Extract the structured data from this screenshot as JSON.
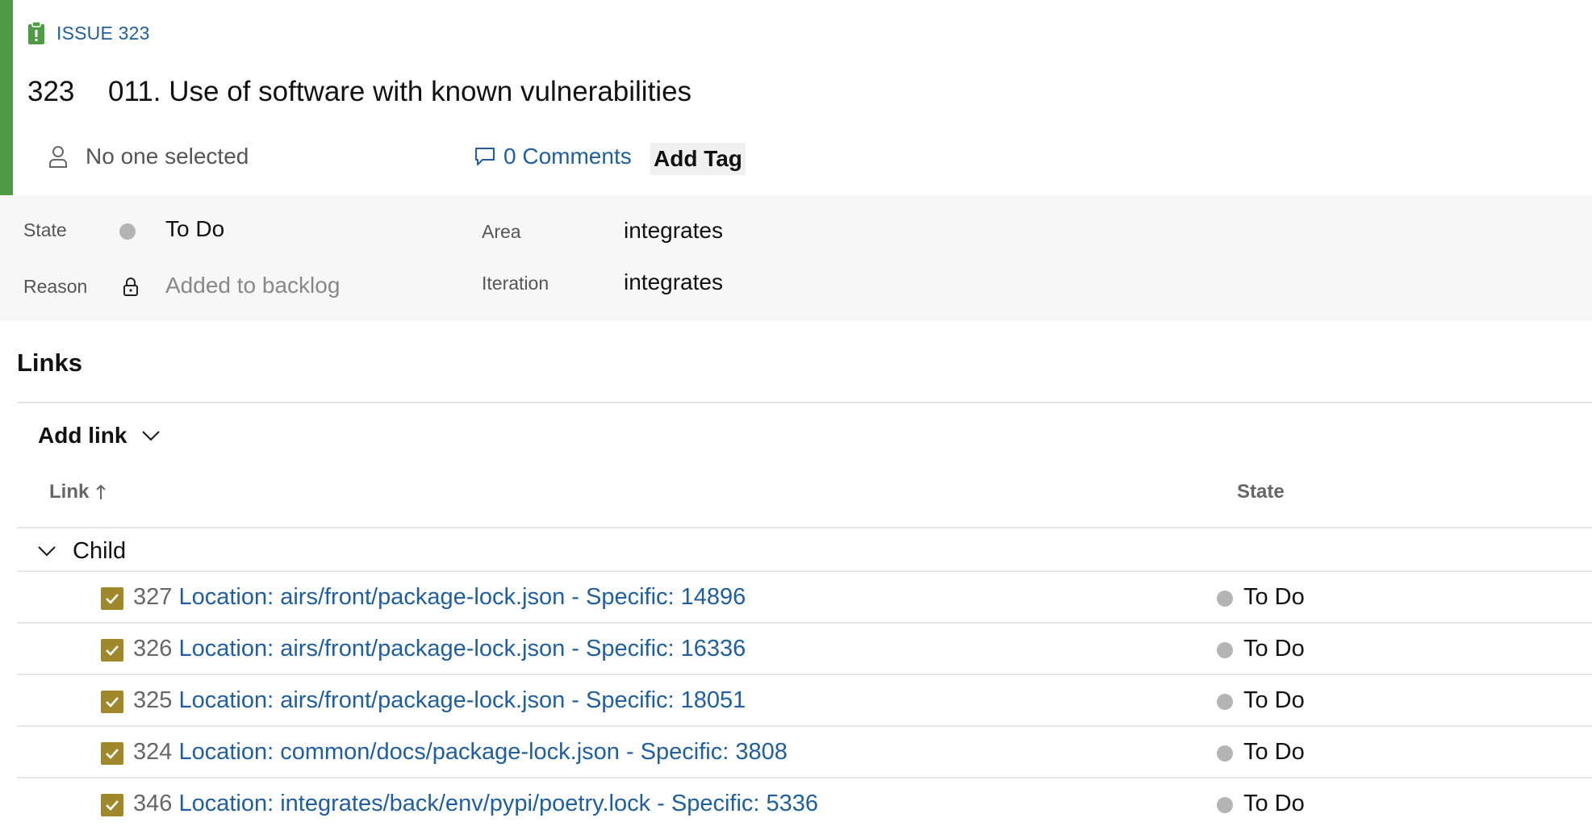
{
  "colors": {
    "accent": "#4f9b45",
    "link": "#1f5fa0",
    "task_icon": "#a0882a",
    "state_dot": "#b4b4b4"
  },
  "header": {
    "type_icon": "clipboard-issue-icon",
    "type_label": "ISSUE 323",
    "id": "323",
    "title": "011. Use of software with known vulnerabilities",
    "assignee": "No one selected",
    "comments": "0 Comments",
    "add_tag": "Add Tag"
  },
  "fields": {
    "state_label": "State",
    "state_value": "To Do",
    "reason_label": "Reason",
    "reason_value": "Added to backlog",
    "area_label": "Area",
    "area_value": "integrates",
    "iteration_label": "Iteration",
    "iteration_value": "integrates"
  },
  "links": {
    "title": "Links",
    "add_link": "Add link",
    "col_link": "Link",
    "col_state": "State",
    "group": "Child",
    "rows": [
      {
        "id": "327",
        "title": "Location: airs/front/package-lock.json - Specific: 14896",
        "state": "To Do"
      },
      {
        "id": "326",
        "title": "Location: airs/front/package-lock.json - Specific: 16336",
        "state": "To Do"
      },
      {
        "id": "325",
        "title": "Location: airs/front/package-lock.json - Specific: 18051",
        "state": "To Do"
      },
      {
        "id": "324",
        "title": "Location: common/docs/package-lock.json - Specific: 3808",
        "state": "To Do"
      },
      {
        "id": "346",
        "title": "Location: integrates/back/env/pypi/poetry.lock - Specific: 5336",
        "state": "To Do"
      }
    ]
  }
}
